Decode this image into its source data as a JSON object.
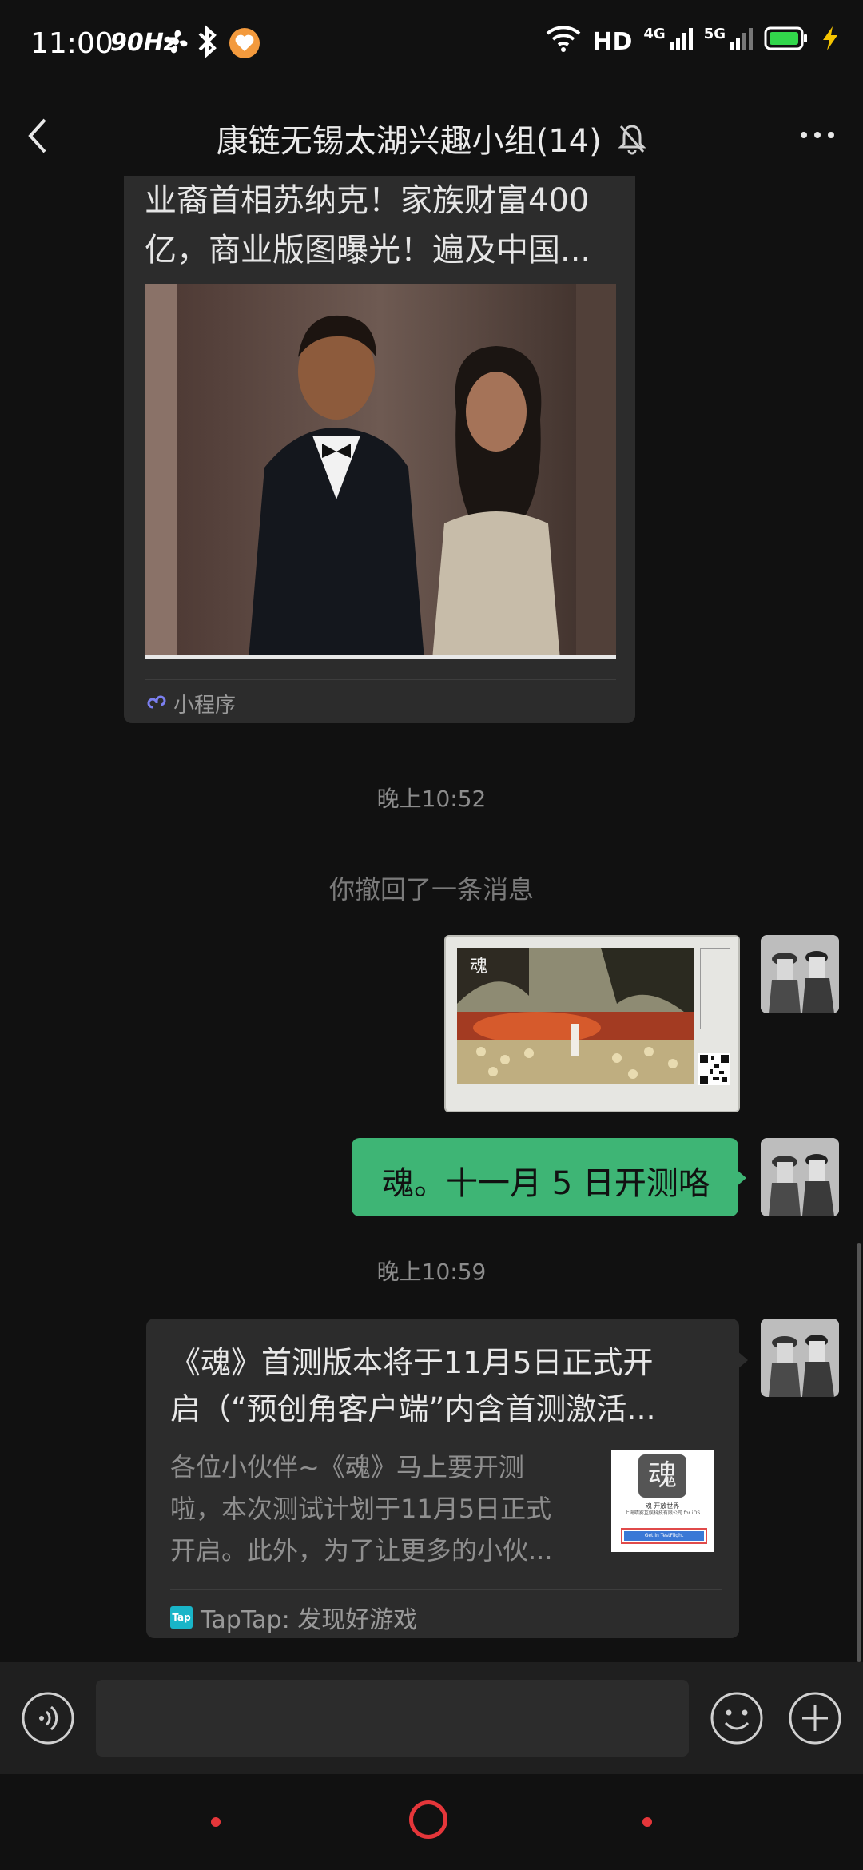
{
  "status": {
    "time": "11:00",
    "refresh": "90Hz",
    "network": "HD",
    "net4g": "4G",
    "net5g": "5G"
  },
  "header": {
    "title": "康链无锡太湖兴趣小组(14)"
  },
  "messages": {
    "article_top": {
      "title_line1": "业裔首相苏纳克！家族财富400",
      "title_line2": "亿，商业版图曝光！遍及中国...",
      "footer": "小程序"
    },
    "time1": "晚上10:52",
    "recalled": "你撤回了一条消息",
    "my_text": "魂。十一月 5 日开测咯",
    "time2": "晚上10:59",
    "link_card": {
      "title_line1": "《魂》首测版本将于11月5日正式开",
      "title_line2": "启（“预创角客户端”内含首测激活...",
      "desc_line1": "各位小伙伴~《魂》马上要开测",
      "desc_line2": "啦，本次测试计划于11月5日正式",
      "desc_line3": "开启。此外，为了让更多的小伙...",
      "thumb_logo": "魂",
      "thumb_line1": "魂 开放世界",
      "thumb_line2": "上海晴雾互娱科技有限公司 for iOS",
      "thumb_button": "Get in TestFlight",
      "source_badge": "Tap",
      "source": "TapTap: 发现好游戏"
    }
  },
  "colors": {
    "background": "#111111",
    "bubble_self": "#3eb575",
    "card": "#2c2c2c",
    "nav_red": "#e5363a",
    "battery": "#32d74b"
  }
}
